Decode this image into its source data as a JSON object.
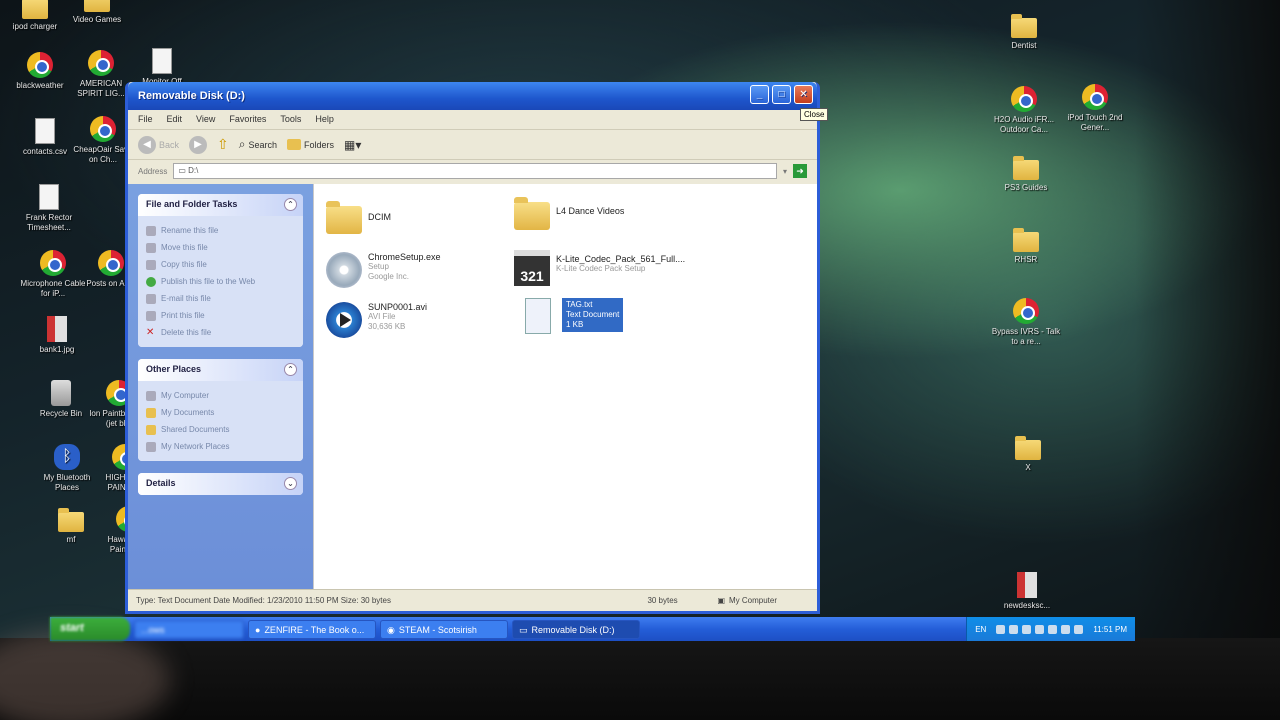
{
  "desktop": {
    "left_icons": [
      {
        "label": "ipod charger",
        "type": "folder"
      },
      {
        "label": "Video Games",
        "type": "folder"
      },
      {
        "label": "blackweather",
        "type": "chrome"
      },
      {
        "label": "AMERICAN SPIRIT LIG...",
        "type": "chrome"
      },
      {
        "label": "Monitor Off",
        "type": "doc"
      },
      {
        "label": "contacts.csv",
        "type": "doc"
      },
      {
        "label": "CheapOair Save on Ch...",
        "type": "chrome"
      },
      {
        "label": "Frank Rector Timesheet...",
        "type": "doc"
      },
      {
        "label": "Microphone Cable for iP...",
        "type": "chrome"
      },
      {
        "label": "Posts on Ap...",
        "type": "chrome"
      },
      {
        "label": "bank1.jpg",
        "type": "redfile"
      },
      {
        "label": "Recycle Bin",
        "type": "recycle"
      },
      {
        "label": "Ion Paintball gun (jet blk)",
        "type": "chrome"
      },
      {
        "label": "My Bluetooth Places",
        "type": "bluetooth"
      },
      {
        "label": "HIGH END PAINTB...",
        "type": "chrome"
      },
      {
        "label": "mf",
        "type": "folder"
      },
      {
        "label": "Hawaii All-S Paintball &",
        "type": "chrome"
      }
    ],
    "right_icons": [
      {
        "label": "Dentist",
        "type": "folder"
      },
      {
        "label": "H2O Audio iFR... Outdoor Ca...",
        "type": "chrome"
      },
      {
        "label": "iPod Touch 2nd Gener...",
        "type": "chrome"
      },
      {
        "label": "PS3 Guides",
        "type": "folder"
      },
      {
        "label": "RHSR",
        "type": "folder"
      },
      {
        "label": "Bypass IVRS - Talk to a re...",
        "type": "chrome"
      },
      {
        "label": "X",
        "type": "folder"
      },
      {
        "label": "newdesksc...",
        "type": "redfile"
      }
    ]
  },
  "window": {
    "title": "Removable Disk (D:)",
    "close_tooltip": "Close",
    "menu": [
      "File",
      "Edit",
      "View",
      "Favorites",
      "Tools",
      "Help"
    ],
    "toolbar": {
      "back": "Back",
      "search": "Search",
      "folders": "Folders"
    },
    "address": {
      "label": "Address",
      "value": "D:\\"
    },
    "tasks_panel": {
      "title": "File and Folder Tasks",
      "items": [
        "Rename this file",
        "Move this file",
        "Copy this file",
        "Publish this file to the Web",
        "E-mail this file",
        "Print this file",
        "Delete this file"
      ]
    },
    "places_panel": {
      "title": "Other Places",
      "items": [
        "My Computer",
        "My Documents",
        "Shared Documents",
        "My Network Places"
      ]
    },
    "details_panel": {
      "title": "Details"
    },
    "files": [
      {
        "name": "DCIM",
        "type": "",
        "size": "",
        "icon": "folder"
      },
      {
        "name": "L4 Dance Videos",
        "type": "",
        "size": "",
        "icon": "folder"
      },
      {
        "name": "ChromeSetup.exe",
        "type": "Setup",
        "size": "Google Inc.",
        "icon": "cd"
      },
      {
        "name": "K-Lite_Codec_Pack_561_Full....",
        "type": "K-Lite Codec Pack Setup",
        "size": "",
        "icon": "klite"
      },
      {
        "name": "SUNP0001.avi",
        "type": "AVI File",
        "size": "30,636 KB",
        "icon": "play"
      },
      {
        "name": "TAG.txt",
        "type": "Text Document",
        "size": "1 KB",
        "icon": "txt",
        "selected": true
      }
    ],
    "status": {
      "info": "Type: Text Document Date Modified: 1/23/2010 11:50 PM Size: 30 bytes",
      "size": "30 bytes",
      "zone": "My Computer"
    }
  },
  "taskbar": {
    "start": "start",
    "tasks": [
      {
        "label": "...ows",
        "active": false
      },
      {
        "label": "ZENFIRE - The Book o...",
        "active": false
      },
      {
        "label": "STEAM - Scotsirish",
        "active": false
      },
      {
        "label": "Removable Disk (D:)",
        "active": true
      }
    ],
    "tray": {
      "lang": "EN",
      "clock": "11:51 PM"
    }
  },
  "colors": {
    "titlebar": "#1e56cc",
    "selection": "#316ac5",
    "taskpane": "#7aa0e0",
    "taskbar": "#245ed8"
  }
}
